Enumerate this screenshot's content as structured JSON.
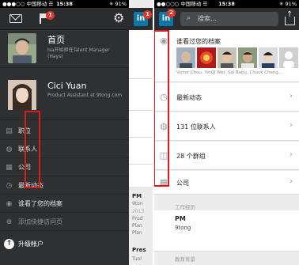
{
  "left": {
    "status": {
      "carrier": "●●●○○ 中国移动 ☰",
      "time": "15:38",
      "battery": "✳ 91%"
    },
    "flag_badge": "1",
    "profiles": [
      {
        "name": "首页",
        "subtitle": "Isa开始担任Talent Manager (Hays)"
      },
      {
        "name": "Cici Yuan",
        "subtitle": "Product Assistant at 9tong.com"
      }
    ],
    "menu": [
      {
        "icon": "briefcase-icon",
        "label": "职位"
      },
      {
        "icon": "contacts-icon",
        "label": "联系人"
      },
      {
        "icon": "building-icon",
        "label": "公司"
      },
      {
        "icon": "clock-icon",
        "label": "最新动态"
      },
      {
        "icon": "eye-icon",
        "label": "谁看了您的档案"
      },
      {
        "icon": "plus-icon",
        "label": "添加快捷访问页"
      }
    ],
    "upgrade_label": "升级帐户",
    "peek": {
      "badge": "1",
      "pm1": "PM",
      "pm1_sub": "9ton",
      "year": "2013",
      "w1": "Prod",
      "w2": "Plan",
      "w3": "Plan",
      "pres": "Pres",
      "tuol": "Tuol"
    }
  },
  "right": {
    "status": {
      "carrier": "●●○○○ 中国移动 ☰",
      "time": "15:38",
      "battery": "✳ 91%"
    },
    "li_badge": "2",
    "search_placeholder": "搜索...",
    "viewers": {
      "label": "谁看过您的档案",
      "names": "Victor Chou, YinQi Wei, Sai Babu, Chuck Cheng,..."
    },
    "rows": [
      {
        "icon": "clock-icon",
        "label": "最新动态"
      },
      {
        "icon": "contacts-icon",
        "label": "131 位联系人"
      },
      {
        "icon": "groups-icon",
        "label": "28 个群组"
      },
      {
        "icon": "building-icon",
        "label": "公司"
      }
    ],
    "section_work": "工作经历",
    "job_title": "PM",
    "job_company": "9tong",
    "section_edu": "教育背景"
  },
  "colors": {
    "menu_bg": "#2f3032",
    "linkedin": "#0e76a8",
    "badge": "#e0352b",
    "highlight": "#e01a1a"
  }
}
